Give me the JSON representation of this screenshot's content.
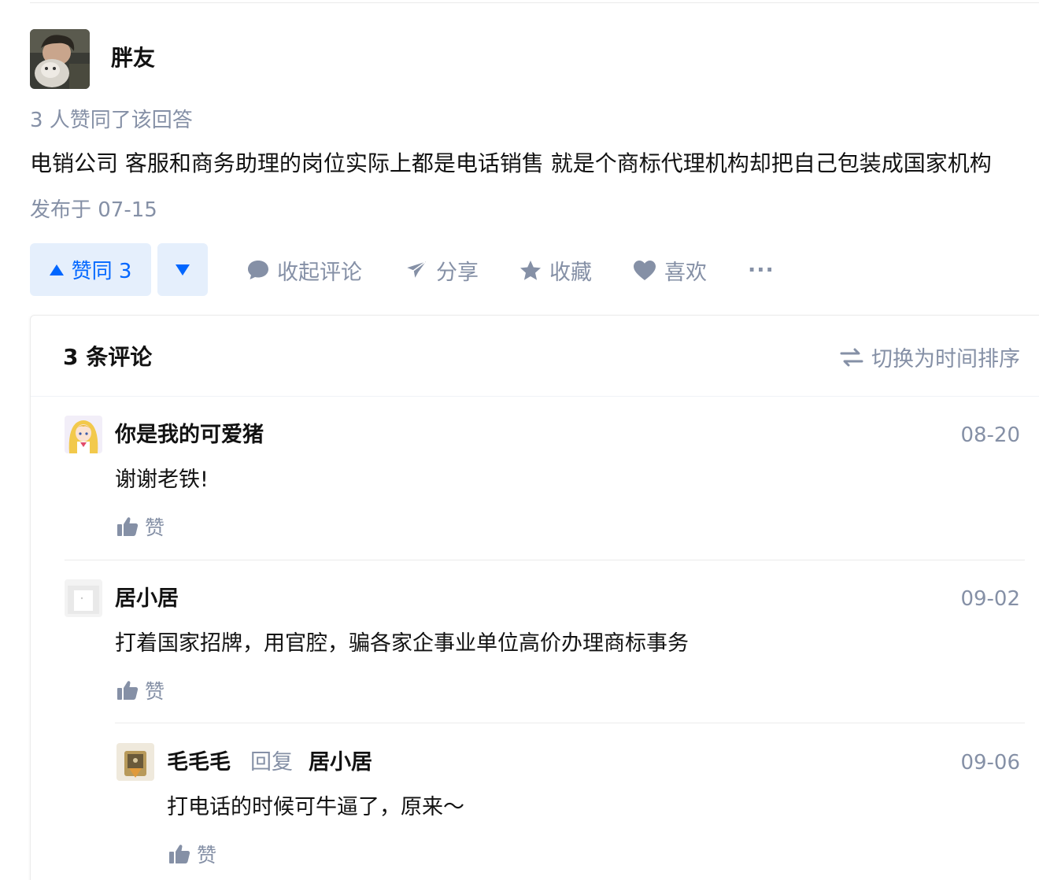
{
  "answer": {
    "author_name": "胖友",
    "upvote_summary": "3 人赞同了该回答",
    "content": "电销公司 客服和商务助理的岗位实际上都是电话销售 就是个商标代理机构却把自己包装成国家机构",
    "publish_date": "发布于 07-15"
  },
  "actions": {
    "vote_up_label": "赞同 3",
    "collapse_comments": "收起评论",
    "share": "分享",
    "favorite": "收藏",
    "like": "喜欢",
    "more": "···"
  },
  "comments": {
    "count_label": "3 条评论",
    "sort_toggle": "切换为时间排序",
    "items": [
      {
        "author": "你是我的可爱猪",
        "time": "08-20",
        "text": "谢谢老铁!",
        "like_label": "赞"
      },
      {
        "author": "居小居",
        "time": "09-02",
        "text": "打着国家招牌，用官腔，骗各家企事业单位高价办理商标事务",
        "like_label": "赞"
      },
      {
        "author": "毛毛毛",
        "reply_word": "回复",
        "reply_to": "居小居",
        "time": "09-06",
        "text": "打电话的时候可牛逼了，原来～",
        "like_label": "赞"
      }
    ]
  },
  "colors": {
    "accent": "#0066ff",
    "vote_bg": "#e5effc",
    "meta_text": "#8590a6",
    "body_text": "#121212"
  },
  "icons": {
    "vote_up": "triangle-up-icon",
    "vote_down": "triangle-down-icon",
    "comment": "comment-bubble-icon",
    "share": "paper-plane-icon",
    "favorite": "star-icon",
    "like": "heart-icon",
    "sort": "swap-arrows-icon",
    "thumb": "thumbs-up-icon"
  }
}
